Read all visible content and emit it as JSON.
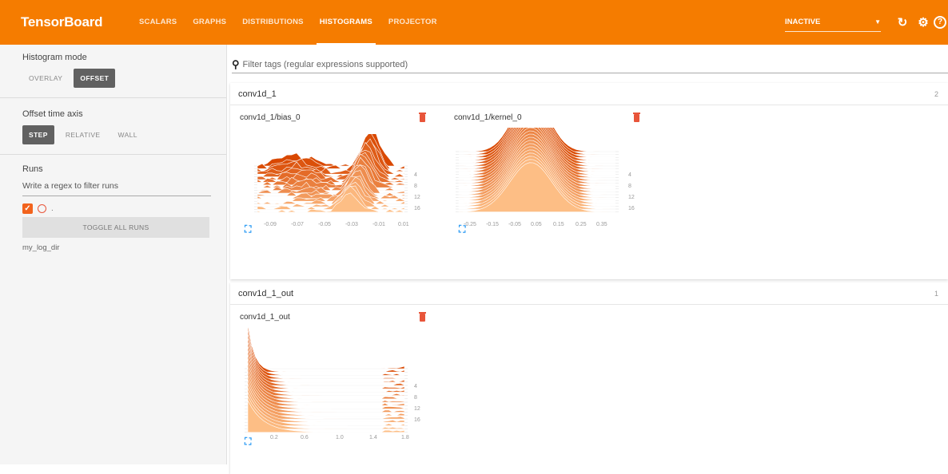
{
  "app": {
    "brand": "TensorBoard",
    "tabs": [
      "SCALARS",
      "GRAPHS",
      "DISTRIBUTIONS",
      "HISTOGRAMS",
      "PROJECTOR"
    ],
    "active_tab": "HISTOGRAMS",
    "status": "INACTIVE",
    "accent_color": "#f57c00"
  },
  "icons": [
    "caret-down-icon",
    "refresh-icon",
    "settings-icon",
    "help-icon",
    "search-icon",
    "trash-icon",
    "expand-icon",
    "checkbox-icon",
    "run-color-circle-icon"
  ],
  "sidebar": {
    "histogram_mode_title": "Histogram mode",
    "mode_buttons": [
      "OVERLAY",
      "OFFSET"
    ],
    "mode_selected": "OFFSET",
    "offset_axis_title": "Offset time axis",
    "offset_buttons": [
      "STEP",
      "RELATIVE",
      "WALL"
    ],
    "offset_selected": "STEP",
    "runs_title": "Runs",
    "runs_filter_placeholder": "Write a regex to filter runs",
    "run_label": ".",
    "toggle_all": "TOGGLE ALL RUNS",
    "log_dir": "my_log_dir"
  },
  "main": {
    "filter_placeholder": "Filter tags (regular expressions supported)",
    "groups": [
      {
        "name": "conv1d_1",
        "count": "2",
        "cards": [
          {
            "title": "conv1d_1/bias_0",
            "x_ticks": [
              "-0.09",
              "-0.07",
              "-0.05",
              "-0.03",
              "-0.01",
              "0.01"
            ],
            "y_ticks": [
              "4",
              "8",
              "12",
              "16"
            ]
          },
          {
            "title": "conv1d_1/kernel_0",
            "x_ticks": [
              "-0.25",
              "-0.15",
              "-0.05",
              "0.05",
              "0.15",
              "0.25",
              "0.35"
            ],
            "y_ticks": [
              "4",
              "8",
              "12",
              "16"
            ]
          }
        ]
      },
      {
        "name": "conv1d_1_out",
        "count": "1",
        "cards": [
          {
            "title": "conv1d_1_out",
            "x_ticks": [
              "0.2",
              "0.6",
              "1.0",
              "1.4",
              "1.8"
            ],
            "y_ticks": [
              "4",
              "8",
              "12",
              "16"
            ]
          }
        ]
      }
    ]
  }
}
